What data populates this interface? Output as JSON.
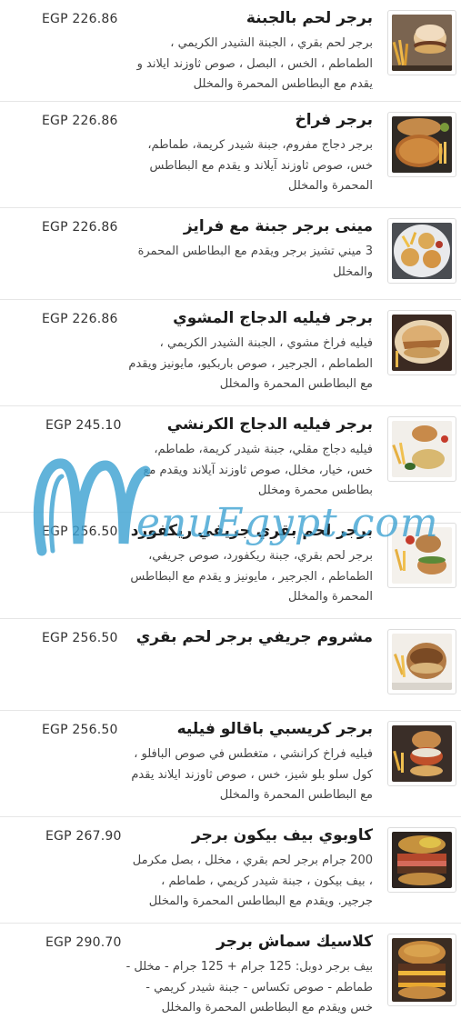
{
  "menu": {
    "items": [
      {
        "name": "برجر لحم بالجبنة",
        "price": "EGP 226.86",
        "desc": "برجر لحم بقري ، الجبنة الشيدر الكريمي ، الطماطم ، الخس ، البصل ، صوص ثاوزند ايلاند و يقدم مع البطاطس المحمرة والمخلل",
        "image": "beef-cheese-burger-photo"
      },
      {
        "name": "برجر فراخ",
        "price": "EGP 226.86",
        "desc": "برجر دجاج مفروم، جبنة شيدر كريمة، طماطم، خس، صوص ثاوزند آيلاند و يقدم مع البطاطس المحمرة والمخلل",
        "image": "chicken-burger-photo"
      },
      {
        "name": "مينى برجر جبنة مع فرايز",
        "price": "EGP 226.86",
        "desc": "3 ميني تشيز برجر ويقدم مع البطاطس المحمرة والمخلل",
        "image": "mini-burgers-photo"
      },
      {
        "name": "برجر فيليه الدجاج المشوي",
        "price": "EGP 226.86",
        "desc": "فيليه فراخ مشوي ، الجبنة الشيدر الكريمي ، الطماطم ، الجرجير ، صوص باربكيو، مايونيز ويقدم مع البطاطس المحمرة والمخلل",
        "image": "grilled-chicken-burger-photo"
      },
      {
        "name": "برجر فيليه الدجاج الكرنشي",
        "price": "EGP 245.10",
        "desc": "فيليه دجاج مقلي، جبنة شيدر كريمة، طماطم، خس، خيار، مخلل، صوص ثاوزند آيلاند ويقدم مع بطاطس محمرة ومخلل",
        "image": "crunchy-chicken-burger-photo"
      },
      {
        "name": "برجر لحم بقري جريفي ريكفورد",
        "price": "EGP 256.50",
        "desc": "برجر لحم بقري، جبنة ريكفورد، صوص جريفي، الطماطم ، الجرجير ، مايونيز و يقدم مع البطاطس المحمرة والمخلل",
        "image": "gravy-roquefort-burger-photo"
      },
      {
        "name": "مشروم جريفي برجر لحم بقري",
        "price": "EGP 256.50",
        "desc": "",
        "image": "mushroom-gravy-burger-photo"
      },
      {
        "name": "برجر كريسبي باقالو فيليه",
        "price": "EGP 256.50",
        "desc": "فيليه فراخ كرانشي ، متغطس في صوص البافلو ، كول سلو بلو شيز، خس ، صوص ثاوزند ايلاند يقدم مع البطاطس المحمرة والمخلل",
        "image": "crispy-buffalo-burger-photo"
      },
      {
        "name": "كاوبوي بيف بيكون برجر",
        "price": "EGP 267.90",
        "desc": "200 جرام برجر لحم بقري ، مخلل ، بصل مكرمل ، بيف بيكون ، جبنة شيدر كريمي ، طماطم ، جرجير. ويقدم مع البطاطس المحمرة والمخلل",
        "image": "cowboy-bacon-burger-photo"
      },
      {
        "name": "كلاسيك سماش برجر",
        "price": "EGP 290.70",
        "desc": "بيف برجر دوبل: 125 جرام + 125 جرام - مخلل - طماطم - صوص تكساس - جبنة شيدر كريمي - خس ويقدم مع البطاطس المحمرة والمخلل",
        "image": "classic-smash-burger-photo"
      }
    ]
  },
  "watermark": {
    "text": "enuEgypt.com",
    "logo": "menuegypt-m-logo",
    "color": "#3fa3d3"
  }
}
